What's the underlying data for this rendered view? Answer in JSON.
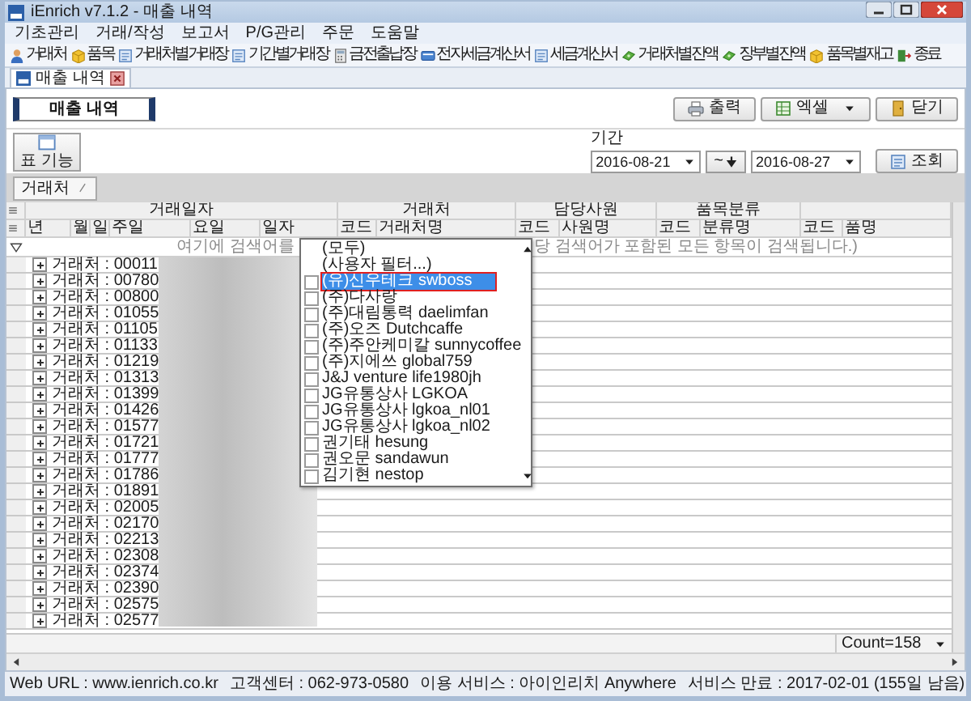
{
  "window": {
    "title": "iEnrich v7.1.2 - 매출 내역"
  },
  "menu": [
    "기초관리",
    "거래/작성",
    "보고서",
    "P/G관리",
    "주문",
    "도움말"
  ],
  "toolbar": [
    {
      "label": "거래처",
      "kind": "person"
    },
    {
      "label": "품목",
      "kind": "box"
    },
    {
      "label": "거래처별거래장",
      "kind": "sheet"
    },
    {
      "label": "기간별거래장",
      "kind": "sheet"
    },
    {
      "label": "금전출납장",
      "kind": "calc"
    },
    {
      "label": "전자세금계산서",
      "kind": "card"
    },
    {
      "label": "세금계산서",
      "kind": "sheet"
    },
    {
      "label": "거래처별잔액",
      "kind": "money"
    },
    {
      "label": "장부별잔액",
      "kind": "money"
    },
    {
      "label": "품목별재고",
      "kind": "box"
    },
    {
      "label": "종료",
      "kind": "exit"
    }
  ],
  "doc_tabs": [
    {
      "label": "매출 내역",
      "selected": true
    }
  ],
  "page_title": "매출 내역",
  "actions": [
    {
      "label": "출력",
      "kind": "print",
      "dropdown": false
    },
    {
      "label": "엑셀",
      "kind": "excel",
      "dropdown": true
    },
    {
      "label": "닫기",
      "kind": "door",
      "dropdown": false
    }
  ],
  "grid_features_button": "표 기능",
  "period": {
    "label": "기간",
    "from": "2016-08-21",
    "range_button": "~",
    "to": "2016-08-27",
    "search_button": "조회"
  },
  "group_panel": [
    "거래처"
  ],
  "grid": {
    "bands": [
      {
        "label": "거래일자",
        "columns": [
          "년",
          "월",
          "일",
          "주일",
          "요일",
          "일자"
        ]
      },
      {
        "label": "거래처",
        "columns": [
          "코드",
          "거래처명"
        ]
      },
      {
        "label": "담당사원",
        "columns": [
          "코드",
          "사원명"
        ]
      },
      {
        "label": "품목분류",
        "columns": [
          "코드",
          "분류명"
        ]
      },
      {
        "columns": [
          "코드",
          "품명"
        ]
      }
    ],
    "filter_left": "여기에 검색어를",
    "filter_right": "당 검색어가 포함된 모든 항목이 검색됩니다.)",
    "rows": [
      {
        "label": "거래처 : 00011",
        "expanded": false
      },
      {
        "label": "거래처 : 00780",
        "expanded": false
      },
      {
        "label": "거래처 : 00800",
        "expanded": false
      },
      {
        "label": "거래처 : 01055",
        "expanded": false
      },
      {
        "label": "거래처 : 01105",
        "expanded": false
      },
      {
        "label": "거래처 : 01133",
        "expanded": false
      },
      {
        "label": "거래처 : 01219",
        "expanded": false
      },
      {
        "label": "거래처 : 01313",
        "expanded": false
      },
      {
        "label": "거래처 : 01399",
        "expanded": false
      },
      {
        "label": "거래처 : 01426",
        "expanded": false
      },
      {
        "label": "거래처 : 01577",
        "expanded": false
      },
      {
        "label": "거래처 : 01721",
        "expanded": false
      },
      {
        "label": "거래처 : 01777",
        "expanded": false
      },
      {
        "label": "거래처 : 01786",
        "expanded": false
      },
      {
        "label": "거래처 : 01891",
        "expanded": false
      },
      {
        "label": "거래처 : 02005",
        "expanded": false
      },
      {
        "label": "거래처 : 02170",
        "expanded": false
      },
      {
        "label": "거래처 : 02213",
        "expanded": false
      },
      {
        "label": "거래처 : 02308",
        "expanded": false
      },
      {
        "label": "거래처 : 02374",
        "expanded": false
      },
      {
        "label": "거래처 : 02390",
        "expanded": false
      },
      {
        "label": "거래처 : 02575",
        "expanded": false
      },
      {
        "label": "거래처 : 02577",
        "expanded": false
      }
    ],
    "count": "Count=158"
  },
  "filter_dropdown": [
    {
      "label": "(모두)",
      "kind": "option",
      "selected": false
    },
    {
      "label": "(사용자 필터...)",
      "kind": "option",
      "selected": false
    },
    {
      "label": "(유)신우테크 swboss",
      "kind": "check",
      "checked": false,
      "selected": true,
      "highlighted": true
    },
    {
      "label": "(주)다사랑",
      "kind": "check",
      "checked": false,
      "selected": false,
      "highlighted": false
    },
    {
      "label": "(주)대림통력 daelimfan",
      "kind": "check",
      "checked": false,
      "selected": false,
      "highlighted": false
    },
    {
      "label": "(주)오즈 Dutchcaffe",
      "kind": "check",
      "checked": false,
      "selected": false,
      "highlighted": false
    },
    {
      "label": "(주)주안케미칼 sunnycoffee",
      "kind": "check",
      "checked": false,
      "selected": false,
      "highlighted": false
    },
    {
      "label": "(주)지에쓰 global759",
      "kind": "check",
      "checked": false,
      "selected": false,
      "highlighted": false
    },
    {
      "label": "J&J venture life1980jh",
      "kind": "check",
      "checked": false,
      "selected": false,
      "highlighted": false
    },
    {
      "label": "JG유통상사 LGKOA",
      "kind": "check",
      "checked": false,
      "selected": false,
      "highlighted": false
    },
    {
      "label": "JG유통상사 lgkoa_nl01",
      "kind": "check",
      "checked": false,
      "selected": false,
      "highlighted": false
    },
    {
      "label": "JG유통상사 lgkoa_nl02",
      "kind": "check",
      "checked": false,
      "selected": false,
      "highlighted": false
    },
    {
      "label": "권기태 hesung",
      "kind": "check",
      "checked": false,
      "selected": false,
      "highlighted": false
    },
    {
      "label": "권오문 sandawun",
      "kind": "check",
      "checked": false,
      "selected": false,
      "highlighted": false
    },
    {
      "label": "김기현 nestop",
      "kind": "check",
      "checked": false,
      "selected": false,
      "highlighted": false
    }
  ],
  "status_bar": [
    "Web URL : www.ienrich.co.kr",
    "고객센터 : 062-973-0580",
    "이용 서비스 : 아이인리치 Anywhere",
    "서비스 만료 : 2017-02-01 (155일 남음)"
  ]
}
